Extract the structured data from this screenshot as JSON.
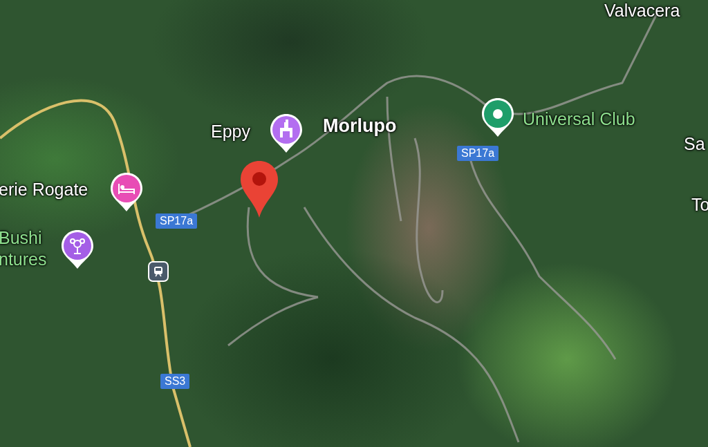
{
  "map": {
    "labels": [
      {
        "text": "Valvacera",
        "kind": "place"
      },
      {
        "text": "Eppy",
        "kind": "place"
      },
      {
        "text": "Morlupo",
        "kind": "town"
      },
      {
        "text": "Universal Club",
        "kind": "poi"
      },
      {
        "text": "Sa",
        "kind": "place"
      },
      {
        "text": "erie Rogate",
        "kind": "place"
      },
      {
        "text": "To",
        "kind": "place"
      },
      {
        "text": "Bushi ntures",
        "kind": "poi"
      }
    ],
    "pins": [
      {
        "kind": "club",
        "color": "#1e9e6a"
      },
      {
        "kind": "museum",
        "color": "#b36ef0"
      },
      {
        "kind": "dropped",
        "color": "#ea4335"
      },
      {
        "kind": "hotel",
        "color": "#e84db5"
      },
      {
        "kind": "attraction",
        "color": "#a45ee6"
      },
      {
        "kind": "transit",
        "color": "#4a5a6a"
      }
    ],
    "road_shields": [
      "SP17a",
      "SP17a",
      "SS3"
    ]
  }
}
